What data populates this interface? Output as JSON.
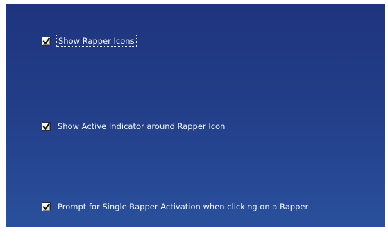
{
  "options": [
    {
      "label": "Show Rapper Icons",
      "checked": true,
      "focused": true
    },
    {
      "label": "Show Active Indicator around Rapper Icon",
      "checked": true,
      "focused": false
    },
    {
      "label": "Prompt for Single Rapper Activation when clicking on a Rapper",
      "checked": true,
      "focused": false
    }
  ],
  "icons": {
    "check": "checkmark-icon"
  },
  "colors": {
    "panel_top": "#1f347e",
    "panel_bottom": "#2a509c",
    "text": "#f2f4fa"
  }
}
